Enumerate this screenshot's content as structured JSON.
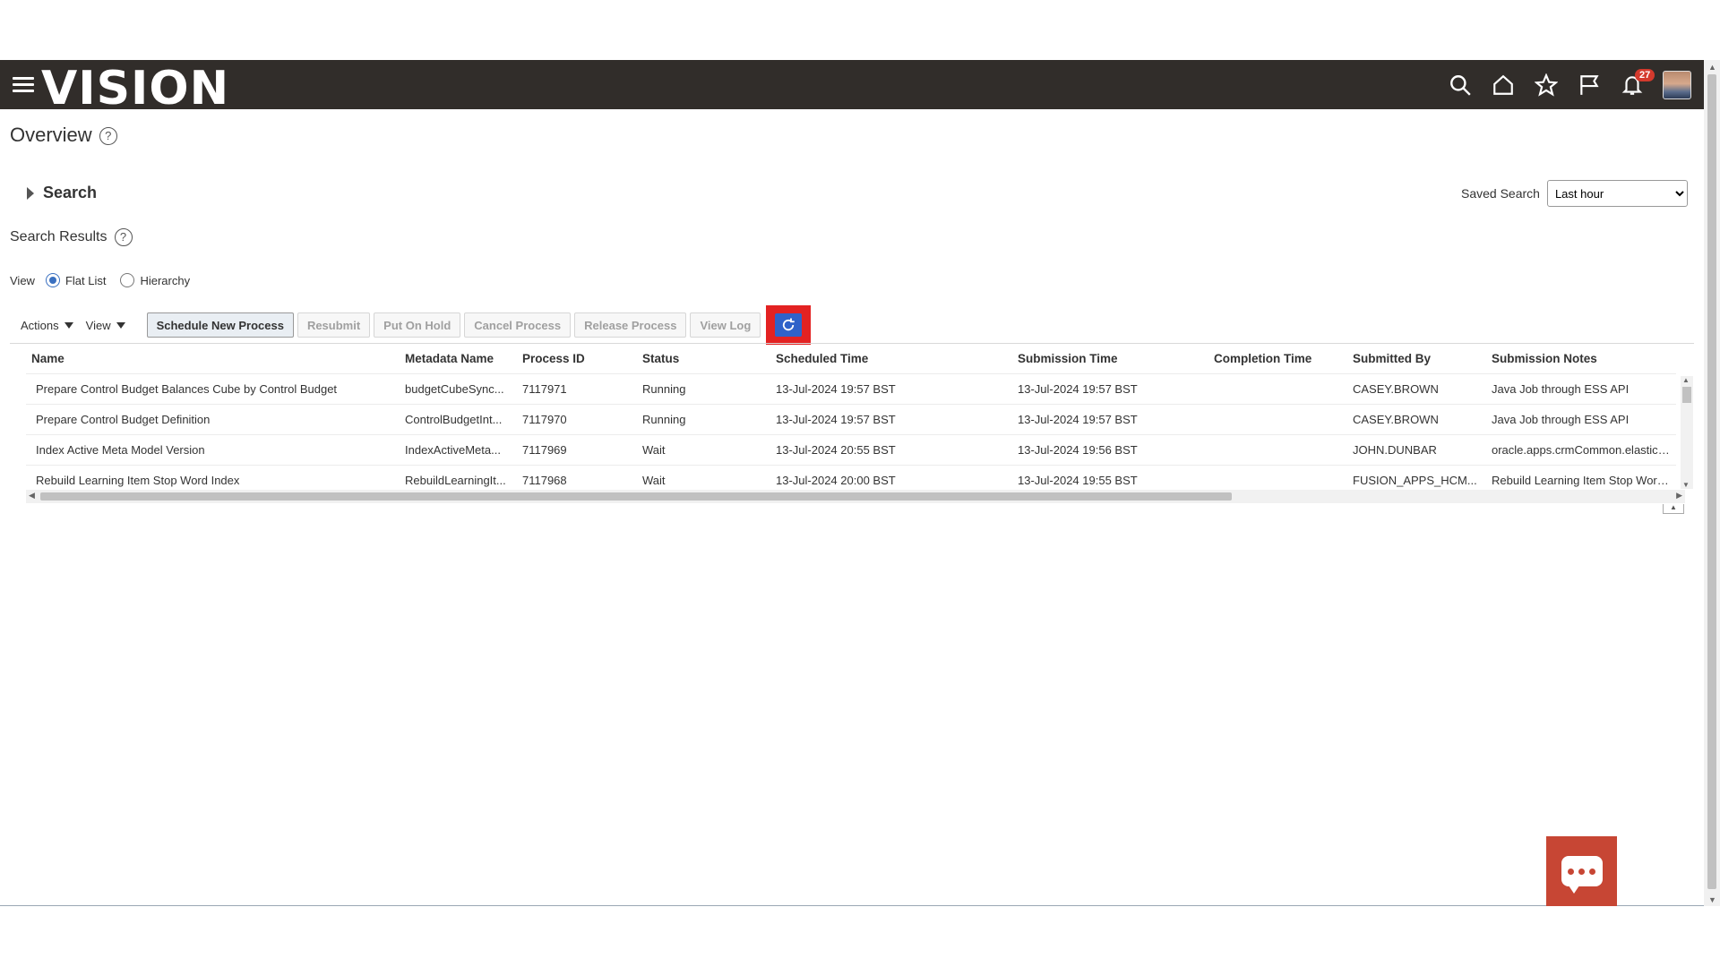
{
  "app": {
    "logo_text": "VISION"
  },
  "nav": {
    "icons": [
      "search-icon",
      "home-icon",
      "star-icon",
      "flag-icon",
      "bell-icon"
    ],
    "notification_count": "27"
  },
  "page": {
    "title": "Overview",
    "help": "?"
  },
  "search": {
    "label": "Search",
    "saved_search_label": "Saved Search",
    "saved_search_value": "Last hour"
  },
  "results": {
    "title": "Search Results",
    "help": "?",
    "view_label": "View",
    "view_options": [
      "Flat List",
      "Hierarchy"
    ],
    "view_selected": "Flat List"
  },
  "toolbar": {
    "actions_label": "Actions",
    "view_label": "View",
    "schedule_label": "Schedule New Process",
    "resubmit_label": "Resubmit",
    "hold_label": "Put On Hold",
    "cancel_label": "Cancel Process",
    "release_label": "Release Process",
    "viewlog_label": "View Log"
  },
  "table": {
    "columns": [
      "Name",
      "Metadata Name",
      "Process ID",
      "Status",
      "Scheduled Time",
      "Submission Time",
      "Completion Time",
      "Submitted By",
      "Submission Notes"
    ],
    "rows": [
      [
        "Prepare Control Budget Balances Cube by Control Budget",
        "budgetCubeSync...",
        "7117971",
        "Running",
        "13-Jul-2024 19:57 BST",
        "13-Jul-2024 19:57 BST",
        "",
        "CASEY.BROWN",
        "Java Job through ESS API"
      ],
      [
        "Prepare Control Budget Definition",
        "ControlBudgetInt...",
        "7117970",
        "Running",
        "13-Jul-2024 19:57 BST",
        "13-Jul-2024 19:57 BST",
        "",
        "CASEY.BROWN",
        "Java Job through ESS API"
      ],
      [
        "Index Active Meta Model Version",
        "IndexActiveMeta...",
        "7117969",
        "Wait",
        "13-Jul-2024 20:55 BST",
        "13-Jul-2024 19:56 BST",
        "",
        "JOHN.DUNBAR",
        "oracle.apps.crmCommon.elasticSea"
      ],
      [
        "Rebuild Learning Item Stop Word Index",
        "RebuildLearningIt...",
        "7117968",
        "Wait",
        "13-Jul-2024 20:00 BST",
        "13-Jul-2024 19:55 BST",
        "",
        "FUSION_APPS_HCM...",
        "Rebuild Learning Item Stop Word In"
      ]
    ]
  },
  "colors": {
    "navbar": "#312d2a",
    "accent": "#2f62c9",
    "highlight": "#e32222",
    "chat": "#c74634"
  }
}
